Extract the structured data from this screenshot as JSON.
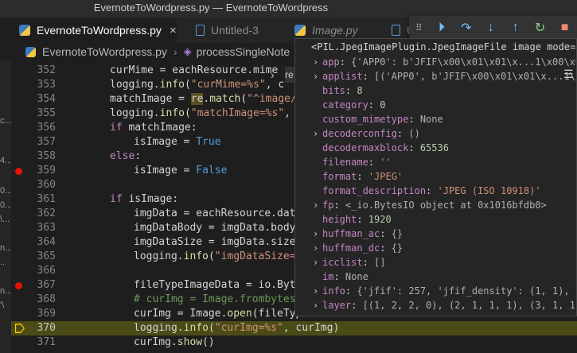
{
  "window": {
    "title": "EvernoteToWordpress.py — EvernoteToWordpress"
  },
  "tabs": [
    {
      "label": "EvernoteToWordpress.py",
      "icon": "python-icon",
      "active": true
    },
    {
      "label": "Untitled-3",
      "icon": "file-icon",
      "active": false
    },
    {
      "label": "Image.py",
      "icon": "python-icon",
      "active": false
    },
    {
      "label": "Ur",
      "icon": "file-icon",
      "active": false
    }
  ],
  "tab_close": "×",
  "debug": {
    "grip": "⠿",
    "continue": "⏵",
    "step_over": "↷",
    "step_into": "↓",
    "step_out": "↑",
    "restart": "↻",
    "stop": "■"
  },
  "breadcrumb": {
    "file": "EvernoteToWordpress.py",
    "symbol": "processSingleNote",
    "sep": "›"
  },
  "left_strip": [
    "c...",
    "4...",
    "0...",
    "0...",
    "\\...",
    "n...",
    "..",
    "n...",
    "'\\"
  ],
  "editor": {
    "lines": [
      {
        "n": "352",
        "text": "curMime = eachResource.mime",
        "indent": 2
      },
      {
        "n": "353",
        "text": "logging.info(\"curMime=%s\", c",
        "indent": 2
      },
      {
        "n": "354",
        "text": "matchImage = re.match(\"^image/\",",
        "indent": 2
      },
      {
        "n": "355",
        "text": "logging.info(\"matchImage=%s\", ma",
        "indent": 2
      },
      {
        "n": "356",
        "text": "if matchImage:",
        "indent": 2
      },
      {
        "n": "357",
        "text": "isImage = True",
        "indent": 3
      },
      {
        "n": "358",
        "text": "else:",
        "indent": 2
      },
      {
        "n": "359",
        "text": "isImage = False",
        "indent": 3,
        "breakpoint": true
      },
      {
        "n": "360",
        "text": "",
        "indent": 2
      },
      {
        "n": "361",
        "text": "if isImage:",
        "indent": 2
      },
      {
        "n": "362",
        "text": "imgData = eachResource.data",
        "indent": 3
      },
      {
        "n": "363",
        "text": "imgDataBody = imgData.body",
        "indent": 3
      },
      {
        "n": "364",
        "text": "imgDataSize = imgData.size",
        "indent": 3
      },
      {
        "n": "365",
        "text": "logging.info(\"imgDataSize=%s",
        "indent": 3
      },
      {
        "n": "366",
        "text": "",
        "indent": 3
      },
      {
        "n": "367",
        "text": "fileTypeImageData = io.Bytes",
        "indent": 3,
        "breakpoint": true
      },
      {
        "n": "368",
        "text": "# curImg = Image.frombytes(\"",
        "indent": 3
      },
      {
        "n": "369",
        "text": "curImg = Image.open(fileType",
        "indent": 3
      },
      {
        "n": "370",
        "text": "logging.info(\"curImg=%s\", curImg)",
        "indent": 3,
        "current": true
      },
      {
        "n": "371",
        "text": "curImg.show()",
        "indent": 3
      }
    ]
  },
  "hover": {
    "header": "<PIL.JpegImagePlugin.JpegImageFile image mode=...",
    "rows": [
      {
        "key": "app",
        "value": "{'APP0': b'JFIF\\x00\\x01\\x01\\x...1\\x00\\x0",
        "expandable": true,
        "kind": "obj"
      },
      {
        "key": "applist",
        "value": "[('APP0', b'JFIF\\x00\\x01\\x01\\x...1\\x",
        "expandable": true,
        "kind": "obj"
      },
      {
        "key": "bits",
        "value": "8",
        "expandable": false,
        "kind": "num"
      },
      {
        "key": "category",
        "value": "0",
        "expandable": false,
        "kind": "num"
      },
      {
        "key": "custom_mimetype",
        "value": "None",
        "expandable": false,
        "kind": "obj"
      },
      {
        "key": "decoderconfig",
        "value": "()",
        "expandable": true,
        "kind": "obj"
      },
      {
        "key": "decodermaxblock",
        "value": "65536",
        "expandable": false,
        "kind": "num"
      },
      {
        "key": "filename",
        "value": "''",
        "expandable": false,
        "kind": "str"
      },
      {
        "key": "format",
        "value": "'JPEG'",
        "expandable": false,
        "kind": "str"
      },
      {
        "key": "format_description",
        "value": "'JPEG (ISO 10918)'",
        "expandable": false,
        "kind": "str"
      },
      {
        "key": "fp",
        "value": "<_io.BytesIO object at 0x1016bfdb0>",
        "expandable": true,
        "kind": "obj"
      },
      {
        "key": "height",
        "value": "1920",
        "expandable": false,
        "kind": "num"
      },
      {
        "key": "huffman_ac",
        "value": "{}",
        "expandable": true,
        "kind": "obj"
      },
      {
        "key": "huffman_dc",
        "value": "{}",
        "expandable": true,
        "kind": "obj"
      },
      {
        "key": "icclist",
        "value": "[]",
        "expandable": true,
        "kind": "obj"
      },
      {
        "key": "im",
        "value": "None",
        "expandable": false,
        "kind": "obj"
      },
      {
        "key": "info",
        "value": "{'jfif': 257, 'jfif_density': (1, 1), '",
        "expandable": true,
        "kind": "obj"
      },
      {
        "key": "layer",
        "value": "[(1, 2, 2, 0), (2, 1, 1, 1), (3, 1, 1,",
        "expandable": true,
        "kind": "obj"
      }
    ]
  },
  "misc": {
    "peek": "›",
    "fragment": "re",
    "menu": "☰"
  }
}
